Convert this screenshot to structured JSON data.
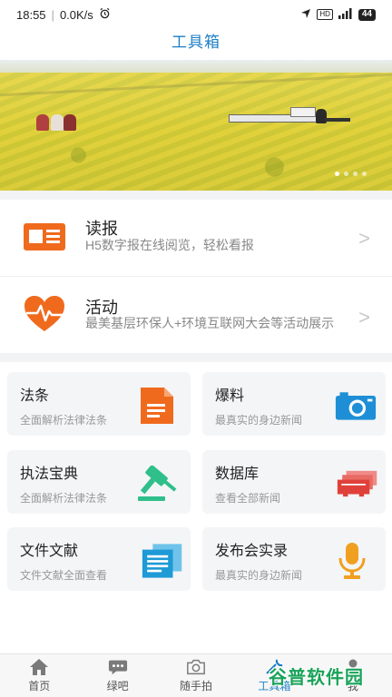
{
  "status_bar": {
    "time": "18:55",
    "network_speed": "0.0K/s",
    "battery": "44",
    "network_badge": "HD"
  },
  "header": {
    "title": "工具箱"
  },
  "banner": {
    "slide_count": 4,
    "active_slide": 1
  },
  "features": [
    {
      "title": "读报",
      "desc": "H5数字报在线阅览，轻松看报",
      "icon": "newspaper-icon",
      "color": "#f06a1e"
    },
    {
      "title": "活动",
      "desc": "最美基层环保人+环境互联网大会等活动展示",
      "icon": "heart-pulse-icon",
      "color": "#f06a1e"
    }
  ],
  "cards": [
    {
      "title": "法条",
      "desc": "全面解析法律法条",
      "icon": "document-icon",
      "color": "#f06a1e"
    },
    {
      "title": "爆料",
      "desc": "最真实的身边新闻",
      "icon": "camera-icon",
      "color": "#1e8fd6"
    },
    {
      "title": "执法宝典",
      "desc": "全面解析法律法条",
      "icon": "gavel-icon",
      "color": "#2fbf8a"
    },
    {
      "title": "数据库",
      "desc": "查看全部新闻",
      "icon": "database-icon",
      "color": "#e0403a"
    },
    {
      "title": "文件文献",
      "desc": "文件文献全面查看",
      "icon": "files-icon",
      "color": "#1e9ad6"
    },
    {
      "title": "发布会实录",
      "desc": "最真实的身边新闻",
      "icon": "microphone-icon",
      "color": "#f0a020"
    }
  ],
  "bottom_nav": [
    {
      "label": "首页",
      "icon": "home-icon"
    },
    {
      "label": "绿吧",
      "icon": "chat-icon"
    },
    {
      "label": "随手拍",
      "icon": "camera-outline-icon"
    },
    {
      "label": "工具箱",
      "icon": "toolbox-icon",
      "active": true
    },
    {
      "label": "我",
      "icon": "user-icon"
    }
  ],
  "watermark": {
    "text": "谷普软件园"
  }
}
